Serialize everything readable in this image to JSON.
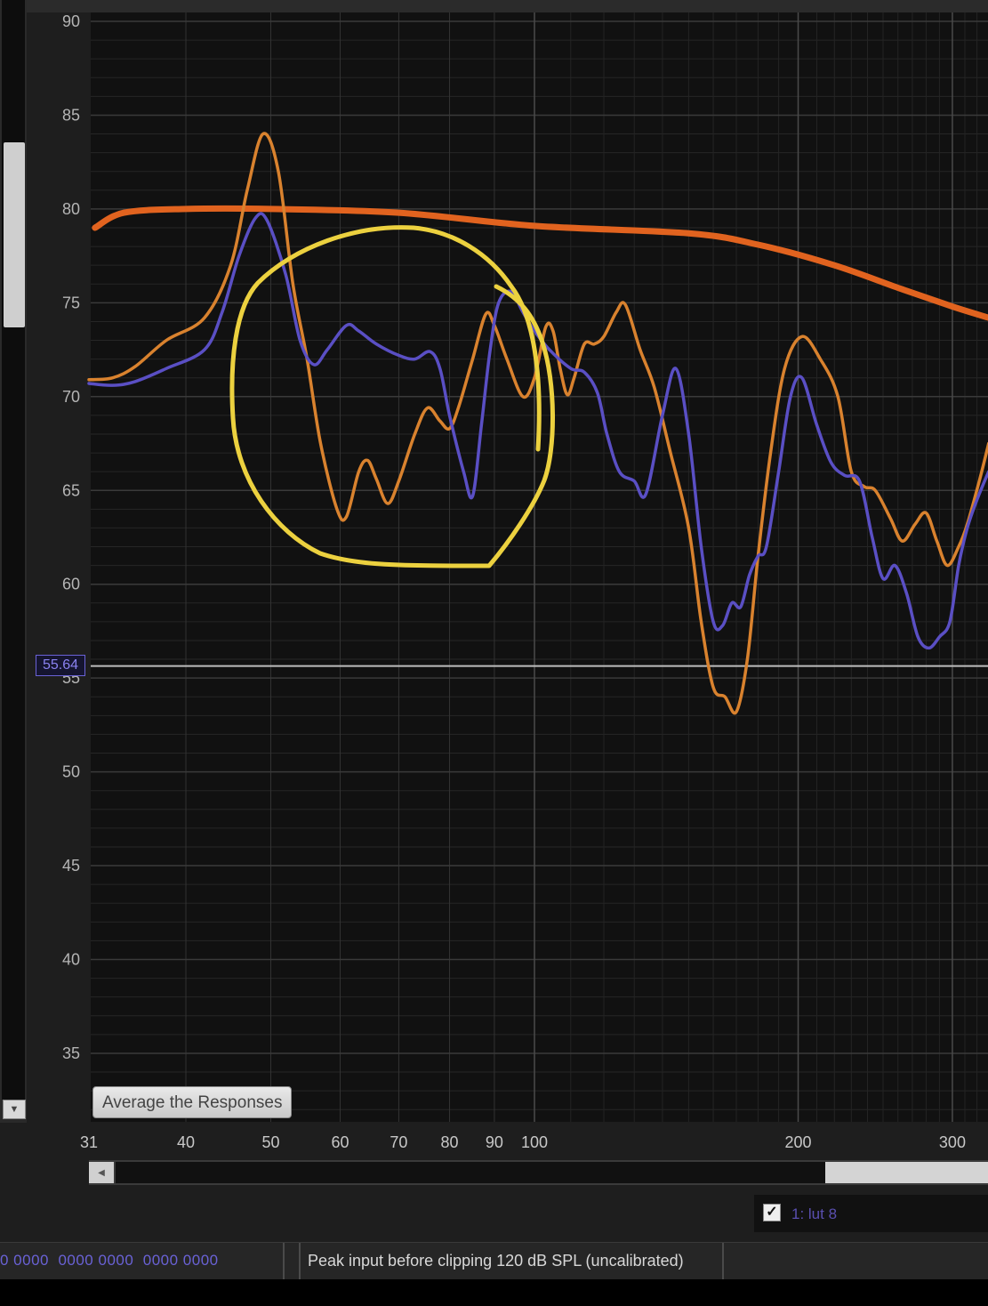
{
  "chart_data": {
    "type": "line",
    "x_scale": "log",
    "xlim": [
      31,
      330
    ],
    "ylim": [
      31,
      90
    ],
    "grid": true,
    "y_ticks": [
      90,
      85,
      80,
      75,
      70,
      65,
      60,
      55,
      50,
      45,
      40,
      35
    ],
    "x_ticks": [
      31,
      40,
      50,
      60,
      70,
      80,
      90,
      100,
      200,
      300
    ],
    "cursor_value": "55.64",
    "cursor_y": 55.64,
    "series": [
      {
        "color": "#e1631f",
        "points": [
          [
            31.5,
            79
          ],
          [
            34,
            79.8
          ],
          [
            40,
            80
          ],
          [
            50,
            80
          ],
          [
            70,
            79.8
          ],
          [
            100,
            79.1
          ],
          [
            150,
            78.7
          ],
          [
            180,
            78.1
          ],
          [
            220,
            77
          ],
          [
            260,
            75.8
          ],
          [
            300,
            74.8
          ],
          [
            330,
            74.2
          ]
        ]
      },
      {
        "color": "#d9822e",
        "points": [
          [
            31,
            70.9
          ],
          [
            33,
            71
          ],
          [
            35,
            71.6
          ],
          [
            38,
            73
          ],
          [
            42,
            74.2
          ],
          [
            45,
            77
          ],
          [
            47,
            81
          ],
          [
            49,
            84
          ],
          [
            51,
            82
          ],
          [
            53,
            76
          ],
          [
            55,
            72
          ],
          [
            57,
            67.5
          ],
          [
            59.5,
            64
          ],
          [
            61,
            63.6
          ],
          [
            63,
            66
          ],
          [
            64.5,
            66.6
          ],
          [
            66,
            65.6
          ],
          [
            68,
            64.3
          ],
          [
            70,
            65.5
          ],
          [
            73,
            68
          ],
          [
            75.5,
            69.4
          ],
          [
            78,
            68.7
          ],
          [
            80,
            68.3
          ],
          [
            82,
            69.5
          ],
          [
            85,
            72
          ],
          [
            88,
            74.4
          ],
          [
            90,
            73.8
          ],
          [
            93,
            72
          ],
          [
            97,
            70
          ],
          [
            100,
            71
          ],
          [
            103,
            73.7
          ],
          [
            105,
            73.5
          ],
          [
            107,
            71.5
          ],
          [
            109,
            70.1
          ],
          [
            111,
            71
          ],
          [
            114,
            72.8
          ],
          [
            117,
            72.8
          ],
          [
            120,
            73.2
          ],
          [
            124,
            74.5
          ],
          [
            127,
            74.9
          ],
          [
            132,
            72.5
          ],
          [
            137,
            70.5
          ],
          [
            143,
            67
          ],
          [
            150,
            63
          ],
          [
            155,
            58
          ],
          [
            160,
            54.5
          ],
          [
            165,
            54
          ],
          [
            170,
            53.2
          ],
          [
            175,
            56
          ],
          [
            180,
            61.5
          ],
          [
            186,
            67
          ],
          [
            193,
            71.5
          ],
          [
            202,
            73.2
          ],
          [
            212,
            72
          ],
          [
            222,
            70
          ],
          [
            230,
            66
          ],
          [
            238,
            65.2
          ],
          [
            245,
            65
          ],
          [
            255,
            63.5
          ],
          [
            263,
            62.3
          ],
          [
            272,
            63.2
          ],
          [
            280,
            63.8
          ],
          [
            288,
            62.3
          ],
          [
            296,
            61
          ],
          [
            305,
            62
          ],
          [
            312,
            63.2
          ],
          [
            322,
            65.5
          ],
          [
            330,
            67.5
          ]
        ]
      },
      {
        "color": "#5a4fc4",
        "points": [
          [
            31,
            70.7
          ],
          [
            33,
            70.6
          ],
          [
            35,
            70.8
          ],
          [
            38,
            71.5
          ],
          [
            42,
            72.5
          ],
          [
            44,
            74.5
          ],
          [
            46,
            77.5
          ],
          [
            48,
            79.5
          ],
          [
            49.5,
            79.4
          ],
          [
            52,
            76.5
          ],
          [
            54,
            73
          ],
          [
            56,
            71.7
          ],
          [
            58,
            72.5
          ],
          [
            61,
            73.8
          ],
          [
            63,
            73.5
          ],
          [
            66,
            72.8
          ],
          [
            70,
            72.2
          ],
          [
            73,
            72
          ],
          [
            76,
            72.4
          ],
          [
            78,
            71.5
          ],
          [
            80,
            69
          ],
          [
            83,
            66
          ],
          [
            85,
            64.7
          ],
          [
            87,
            68.5
          ],
          [
            89,
            72.5
          ],
          [
            91,
            75
          ],
          [
            94,
            75.6
          ],
          [
            97,
            74.5
          ],
          [
            100,
            73.5
          ],
          [
            104,
            72.5
          ],
          [
            110,
            71.5
          ],
          [
            114,
            71.3
          ],
          [
            118,
            70.2
          ],
          [
            121,
            68
          ],
          [
            125,
            66
          ],
          [
            130,
            65.5
          ],
          [
            134,
            64.8
          ],
          [
            140,
            69
          ],
          [
            145,
            71.5
          ],
          [
            150,
            68
          ],
          [
            155,
            62
          ],
          [
            160,
            58
          ],
          [
            164,
            57.8
          ],
          [
            168,
            59
          ],
          [
            172,
            58.8
          ],
          [
            176,
            60.5
          ],
          [
            180,
            61.5
          ],
          [
            184,
            62
          ],
          [
            190,
            66
          ],
          [
            196,
            70
          ],
          [
            202,
            71
          ],
          [
            210,
            68.5
          ],
          [
            218,
            66.5
          ],
          [
            226,
            65.8
          ],
          [
            235,
            65.5
          ],
          [
            243,
            62.5
          ],
          [
            250,
            60.3
          ],
          [
            258,
            61
          ],
          [
            266,
            59.5
          ],
          [
            274,
            57.2
          ],
          [
            282,
            56.6
          ],
          [
            290,
            57.2
          ],
          [
            298,
            58
          ],
          [
            305,
            61
          ],
          [
            312,
            63
          ],
          [
            320,
            64.5
          ],
          [
            330,
            66
          ]
        ]
      }
    ]
  },
  "annotation": {
    "color": "#ecd13f"
  },
  "button": {
    "average_label": "Average the Responses"
  },
  "legend": {
    "item_label": "1: lut 8"
  },
  "status": {
    "hex_text": "0 0000  0000 0000  0000 0000",
    "peak_text": "Peak input before clipping 120 dB SPL (uncalibrated)"
  }
}
